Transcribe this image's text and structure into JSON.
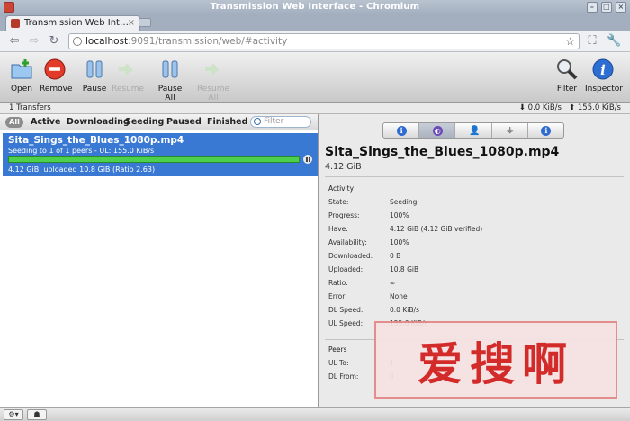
{
  "window": {
    "title": "Transmission Web Interface - Chromium"
  },
  "browser": {
    "tab_title": "Transmission Web Int…",
    "url_host": "localhost",
    "url_path": ":9091/transmission/web/#activity"
  },
  "toolbar": {
    "open": "Open",
    "remove": "Remove",
    "pause": "Pause",
    "resume": "Resume",
    "pause_all": "Pause All",
    "resume_all": "Resume All",
    "filter": "Filter",
    "inspector": "Inspector"
  },
  "status": {
    "transfers": "1 Transfers",
    "down_speed": "0.0 KiB/s",
    "up_speed": "155.0 KiB/s"
  },
  "filters": {
    "all": "All",
    "active": "Active",
    "downloading": "Downloading",
    "seeding": "Seeding",
    "paused": "Paused",
    "finished": "Finished",
    "search_placeholder": "Filter"
  },
  "torrent": {
    "name": "Sita_Sings_the_Blues_1080p.mp4",
    "peer_status": "Seeding to 1 of 1 peers - UL: 155.0 KiB/s",
    "progress": 1.0,
    "stats": "4.12 GiB, uploaded 10.8 GiB (Ratio 2.63)"
  },
  "inspector": {
    "title": "Sita_Sings_the_Blues_1080p.mp4",
    "size": "4.12 GiB",
    "activity_heading": "Activity",
    "activity": [
      {
        "k": "State:",
        "v": "Seeding"
      },
      {
        "k": "Progress:",
        "v": "100%"
      },
      {
        "k": "Have:",
        "v": "4.12 GiB (4.12 GiB verified)"
      },
      {
        "k": "Availability:",
        "v": "100%"
      },
      {
        "k": "Downloaded:",
        "v": "0 B"
      },
      {
        "k": "Uploaded:",
        "v": "10.8 GiB"
      },
      {
        "k": "Ratio:",
        "v": "∞"
      },
      {
        "k": "Error:",
        "v": "None"
      },
      {
        "k": "DL Speed:",
        "v": "0.0 KiB/s"
      },
      {
        "k": "UL Speed:",
        "v": "155.0 KiB/s"
      }
    ],
    "peers_heading": "Peers",
    "peers": [
      {
        "k": "UL To:",
        "v": "1"
      },
      {
        "k": "DL From:",
        "v": "0"
      }
    ]
  },
  "watermark": {
    "text": "爱搜啊"
  },
  "colors": {
    "selection": "#3a79d3",
    "progress": "#4dd04d",
    "watermark": "#d21a1a"
  }
}
